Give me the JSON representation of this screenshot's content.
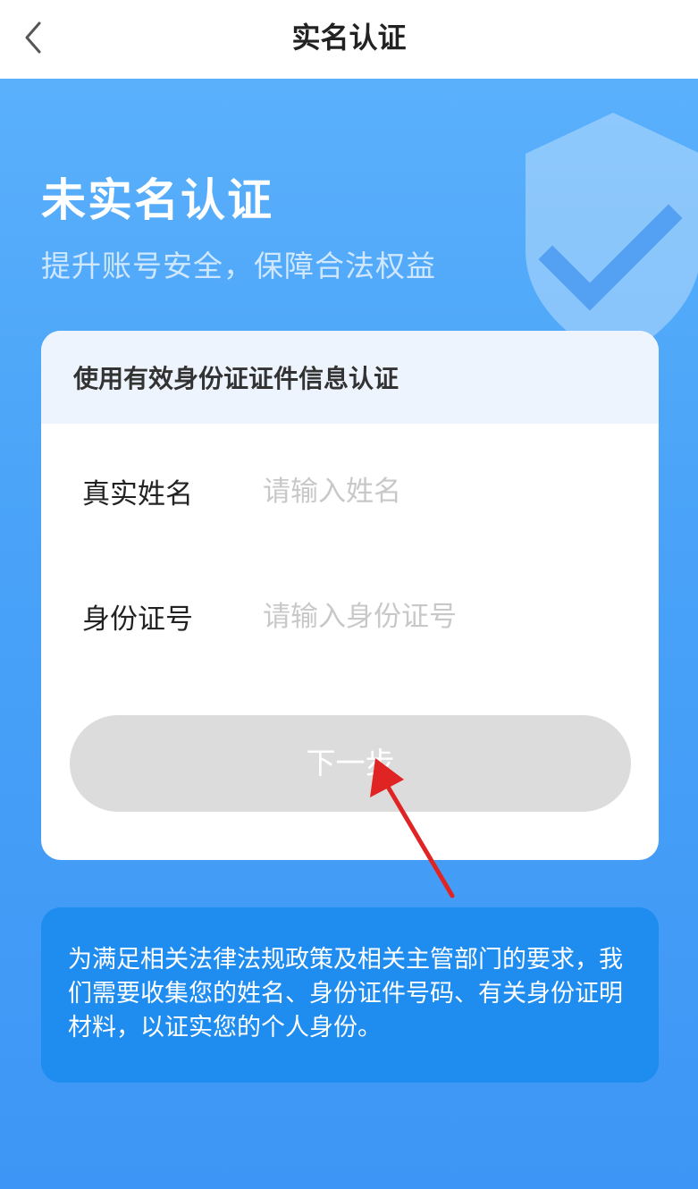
{
  "topbar": {
    "title": "实名认证",
    "back_icon": "chevron-left-icon"
  },
  "hero": {
    "title": "未实名认证",
    "subtitle": "提升账号安全，保障合法权益",
    "shield_icon": "shield-check-icon"
  },
  "card": {
    "header": "使用有效身份证证件信息认证",
    "name_label": "真实姓名",
    "name_placeholder": "请输入姓名",
    "name_value": "",
    "id_label": "身份证号",
    "id_placeholder": "请输入身份证号",
    "id_value": "",
    "next_button": "下一步"
  },
  "notice": {
    "text": "为满足相关法律法规政策及相关主管部门的要求，我们需要收集您的姓名、身份证件号码、有关身份证明材料，以证实您的个人身份。"
  },
  "colors": {
    "accent": "#4aa3f8",
    "notice_bg": "#1f8cef",
    "button_disabled": "#dcdcdc",
    "annotation_arrow": "#e02424"
  }
}
